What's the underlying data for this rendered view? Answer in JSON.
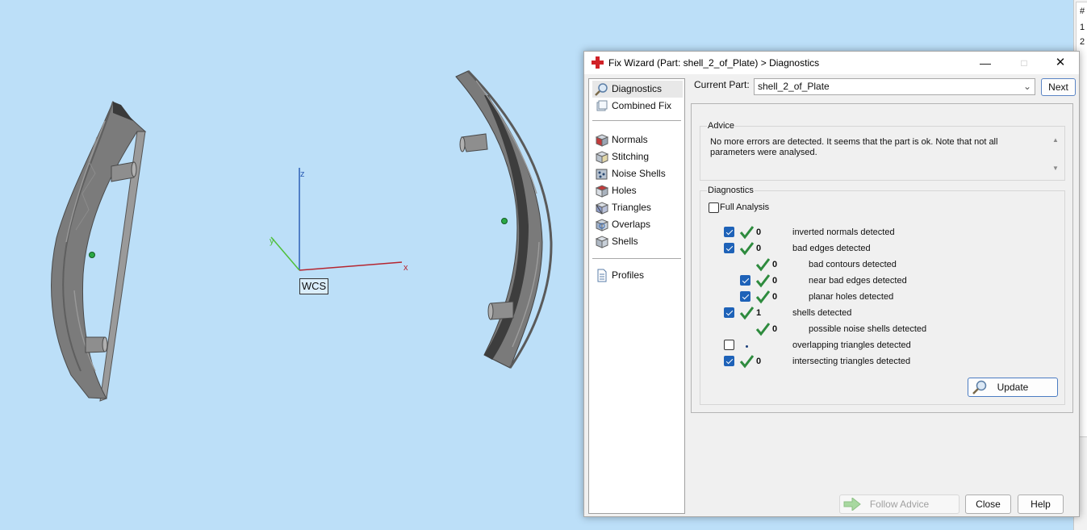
{
  "scene": {
    "axes": {
      "z_label": "z",
      "y_label": "y",
      "x_label": "x",
      "frame_label": "WCS"
    }
  },
  "side_panel": {
    "texts": [
      "#",
      "1",
      "2"
    ]
  },
  "dialog": {
    "title": "Fix Wizard (Part: shell_2_of_Plate) > Diagnostics",
    "nav": [
      {
        "label": "Diagnostics",
        "icon": "magnifier-icon",
        "selected": true
      },
      {
        "label": "Combined Fix",
        "icon": "combined-fix-icon"
      },
      {
        "label": "Normals",
        "icon": "normals-cube-icon"
      },
      {
        "label": "Stitching",
        "icon": "stitching-icon"
      },
      {
        "label": "Noise Shells",
        "icon": "noise-shells-icon"
      },
      {
        "label": "Holes",
        "icon": "holes-icon"
      },
      {
        "label": "Triangles",
        "icon": "triangles-icon"
      },
      {
        "label": "Overlaps",
        "icon": "overlaps-icon"
      },
      {
        "label": "Shells",
        "icon": "shells-icon"
      },
      {
        "label": "Profiles",
        "icon": "profiles-document-icon"
      }
    ],
    "current_part_label": "Current Part:",
    "current_part_value": "shell_2_of_Plate",
    "next_label": "Next",
    "advice_title": "Advice",
    "advice_text": "No more errors are detected. It seems that the part is ok. Note that not all parameters were analysed.",
    "diagnostics_title": "Diagnostics",
    "full_analysis_label": "Full Analysis",
    "full_analysis_checked": false,
    "rows": [
      {
        "checked": true,
        "count": "0",
        "label": "inverted normals detected",
        "status": "ok"
      },
      {
        "checked": true,
        "count": "0",
        "label": "bad edges detected",
        "status": "ok"
      },
      {
        "checked": null,
        "count": "0",
        "label": "bad contours detected",
        "status": "ok"
      },
      {
        "checked": true,
        "count": "0",
        "label": "near bad edges detected",
        "status": "ok"
      },
      {
        "checked": true,
        "count": "0",
        "label": "planar holes detected",
        "status": "ok"
      },
      {
        "checked": true,
        "count": "1",
        "label": "shells detected",
        "status": "ok"
      },
      {
        "checked": null,
        "count": "0",
        "label": "possible noise shells detected",
        "status": "ok"
      },
      {
        "checked": false,
        "count": "",
        "label": "overlapping triangles detected",
        "status": "not-analysed"
      },
      {
        "checked": true,
        "count": "0",
        "label": "intersecting triangles detected",
        "status": "ok"
      }
    ],
    "update_label": "Update",
    "follow_advice_label": "Follow Advice",
    "close_label": "Close",
    "help_label": "Help"
  },
  "colors": {
    "viewport_bg": "#bcdff8",
    "check_green": "#2e8b3e",
    "checkbox_blue": "#1e62b8",
    "axis_z": "#2d5fb5",
    "axis_y": "#4fc03a",
    "axis_x": "#b52630"
  }
}
